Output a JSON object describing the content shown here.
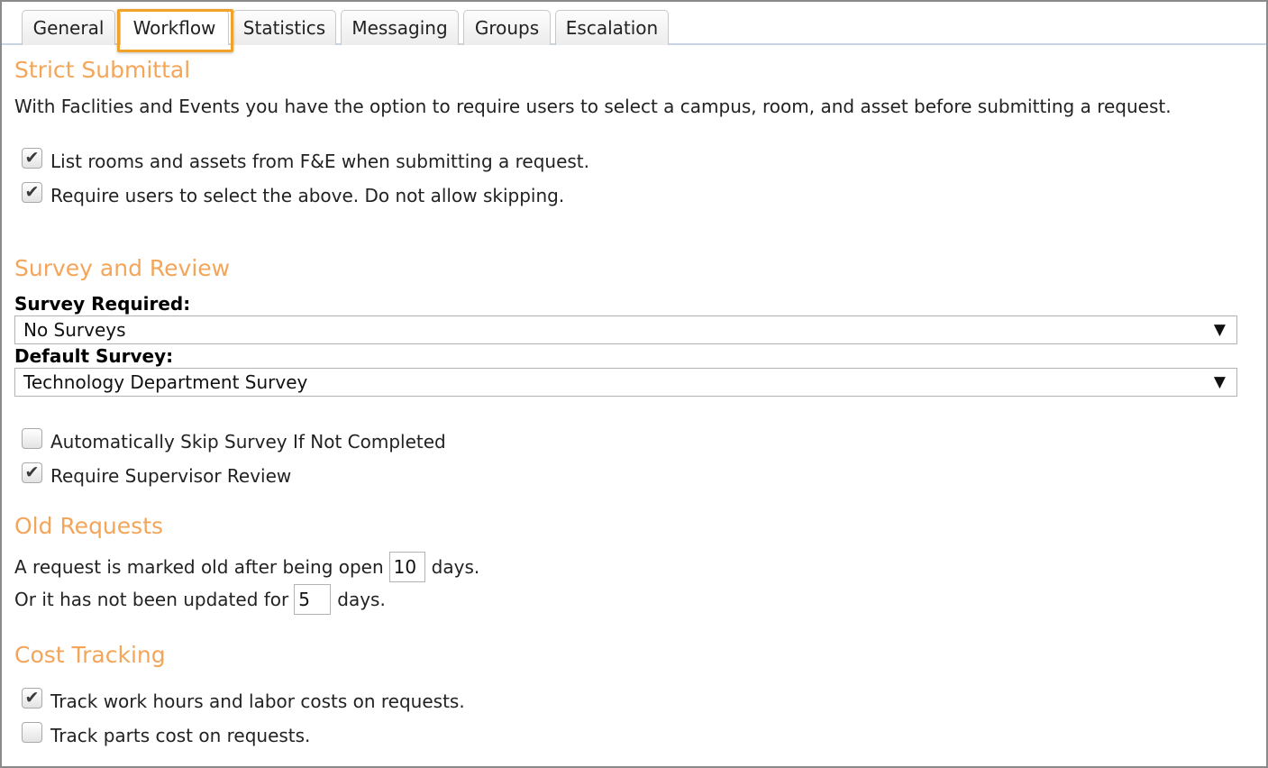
{
  "tabs": [
    {
      "label": "General"
    },
    {
      "label": "Workflow"
    },
    {
      "label": "Statistics"
    },
    {
      "label": "Messaging"
    },
    {
      "label": "Groups"
    },
    {
      "label": "Escalation"
    }
  ],
  "active_tab": "Workflow",
  "strict_submittal": {
    "title": "Strict Submittal",
    "description": "With Faclities and Events you have the option to require users to select a campus, room, and asset before submitting a request.",
    "options": [
      {
        "label": "List rooms and assets from F&E when submitting a request.",
        "checked": true
      },
      {
        "label": "Require users to select the above. Do not allow skipping.",
        "checked": true
      }
    ]
  },
  "survey_review": {
    "title": "Survey and Review",
    "survey_required_label": "Survey Required:",
    "survey_required_value": "No Surveys",
    "default_survey_label": "Default Survey:",
    "default_survey_value": "Technology Department Survey",
    "options": [
      {
        "label": "Automatically Skip Survey If Not Completed",
        "checked": false
      },
      {
        "label": "Require Supervisor Review",
        "checked": true
      }
    ]
  },
  "old_requests": {
    "title": "Old Requests",
    "line1_prefix": "A request is marked old after being open",
    "line1_value": "10",
    "line1_suffix": "days.",
    "line2_prefix": "Or it has not been updated for",
    "line2_value": "5",
    "line2_suffix": "days."
  },
  "cost_tracking": {
    "title": "Cost Tracking",
    "options": [
      {
        "label": "Track work hours and labor costs on requests.",
        "checked": true
      },
      {
        "label": "Track parts cost on requests.",
        "checked": false
      }
    ]
  },
  "colors": {
    "section_title": "#f3a55a",
    "tab_highlight": "#f0a32a"
  },
  "icons": {
    "check": "✔",
    "dropdown_arrow": "▼"
  }
}
